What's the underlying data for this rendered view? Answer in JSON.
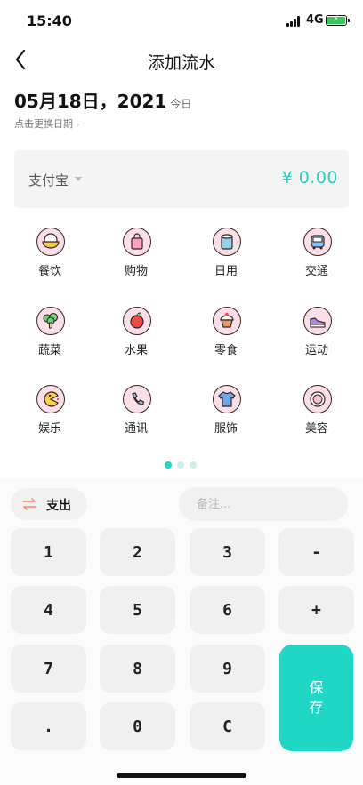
{
  "status_bar": {
    "time": "15:40",
    "network": "4G"
  },
  "nav": {
    "title": "添加流水",
    "back_icon": "chevron-left-icon"
  },
  "date": {
    "main": "05月18日，2021",
    "today": "今日",
    "hint": "点击更换日期",
    "hint_icon": "chevron-right-icon"
  },
  "account": {
    "name": "支付宝",
    "amount": "¥ 0.00"
  },
  "categories": [
    {
      "label": "餐饮",
      "icon": "rice-bowl-icon"
    },
    {
      "label": "购物",
      "icon": "shopping-bag-icon"
    },
    {
      "label": "日用",
      "icon": "toilet-paper-icon"
    },
    {
      "label": "交通",
      "icon": "bus-icon"
    },
    {
      "label": "蔬菜",
      "icon": "broccoli-icon"
    },
    {
      "label": "水果",
      "icon": "apple-icon"
    },
    {
      "label": "零食",
      "icon": "cupcake-icon"
    },
    {
      "label": "运动",
      "icon": "sneaker-icon"
    },
    {
      "label": "娱乐",
      "icon": "pacman-icon"
    },
    {
      "label": "通讯",
      "icon": "phone-icon"
    },
    {
      "label": "服饰",
      "icon": "tshirt-icon"
    },
    {
      "label": "美容",
      "icon": "compact-mirror-icon"
    }
  ],
  "pager": {
    "total": 3,
    "active": 0
  },
  "keypad": {
    "type_label": "支出",
    "note_placeholder": "备注...",
    "keys": [
      "1",
      "2",
      "3",
      "-",
      "4",
      "5",
      "6",
      "+",
      "7",
      "8",
      "9",
      ".",
      "0",
      "C"
    ],
    "save_label": "保存"
  },
  "colors": {
    "accent": "#20d6c4",
    "amount": "#25d0c0",
    "icon_bg": "#f9dfe8",
    "swap_icon": "#f08a6a"
  }
}
